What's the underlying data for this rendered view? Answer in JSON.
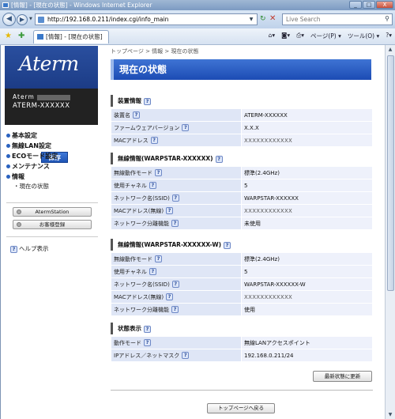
{
  "window": {
    "title": "[情報] - [現在の状態] - Windows Internet Explorer",
    "controls": [
      "_",
      "□",
      "X"
    ]
  },
  "address_bar": {
    "url": "http://192.168.0.211/index.cgi/info_main",
    "search_placeholder": "Live Search"
  },
  "favorites_bar": {
    "tab_label": "[情報] - [現在の状態]",
    "tools": [
      "ページ(P) ▾",
      "ツール(O) ▾"
    ]
  },
  "sidebar": {
    "logo": "Aterm",
    "model_line1": "Aterm",
    "model_line2": "ATERM-XXXXXX",
    "save_label": "保存",
    "menu": [
      {
        "label": "基本設定"
      },
      {
        "label": "無線LAN設定"
      },
      {
        "label": "ECOモード設定"
      },
      {
        "label": "メンテナンス"
      },
      {
        "label": "情報"
      }
    ],
    "submenu_current": "・現在の状態",
    "aterm_station_label": "AtermStation",
    "registration_label": "お客様登録",
    "help_label": "ヘルプ表示"
  },
  "main": {
    "breadcrumb": "トップページ > 情報 > 現在の状態",
    "page_title": "現在の状態",
    "sections": [
      {
        "title": "装置情報",
        "rows": [
          {
            "label": "装置名",
            "value": "ATERM-XXXXXX"
          },
          {
            "label": "ファームウェアバージョン",
            "value": "X.X.X"
          },
          {
            "label": "MACアドレス",
            "value": "XXXXXXXXXXXX"
          }
        ]
      },
      {
        "title": "無線情報(WARPSTAR-XXXXXX)",
        "rows": [
          {
            "label": "無線動作モード",
            "value": "標準(2.4GHz)"
          },
          {
            "label": "使用チャネル",
            "value": "5"
          },
          {
            "label": "ネットワーク名(SSID)",
            "value": "WARPSTAR-XXXXXX"
          },
          {
            "label": "MACアドレス(無線)",
            "value": "XXXXXXXXXXXX"
          },
          {
            "label": "ネットワーク分離機能",
            "value": "未使用"
          }
        ]
      },
      {
        "title": "無線情報(WARPSTAR-XXXXXX-W)",
        "rows": [
          {
            "label": "無線動作モード",
            "value": "標準(2.4GHz)"
          },
          {
            "label": "使用チャネル",
            "value": "5"
          },
          {
            "label": "ネットワーク名(SSID)",
            "value": "WARPSTAR-XXXXXX-W"
          },
          {
            "label": "MACアドレス(無線)",
            "value": "XXXXXXXXXXXX"
          },
          {
            "label": "ネットワーク分離機能",
            "value": "使用"
          }
        ]
      },
      {
        "title": "状態表示",
        "rows": [
          {
            "label": "動作モード",
            "value": "無線LANアクセスポイント"
          },
          {
            "label": "IPアドレス／ネットマスク",
            "value": "192.168.0.211/24"
          }
        ]
      }
    ],
    "refresh_label": "最新状態に更新",
    "top_page_label": "トップページへ戻る"
  }
}
